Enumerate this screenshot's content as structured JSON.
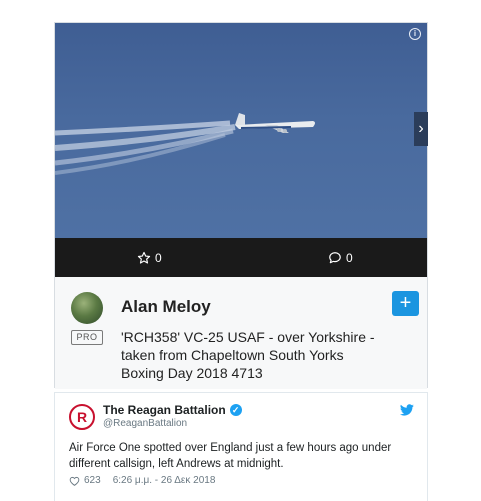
{
  "photo": {
    "favorites_count": "0",
    "comments_count": "0"
  },
  "author": {
    "name": "Alan Meloy",
    "badge": "PRO",
    "photo_title": "'RCH358' VC-25 USAF - over Yorkshire - taken from Chapeltown South Yorks Boxing Day 2018 4713",
    "follow_label": "+"
  },
  "tweet": {
    "account_name": "The Reagan Battalion",
    "handle": "@ReaganBattalion",
    "text": "Air Force One spotted over England  just a few hours ago under different callsign, left Andrews at midnight.",
    "likes": "623",
    "time": "6:26 μ.μ. - 26 Δεκ 2018",
    "verified_mark": "✓",
    "logo_letter": "R"
  },
  "icons": {
    "info": "info-icon",
    "next": "chevron-right-icon",
    "star": "star-icon",
    "comment": "comment-icon",
    "follow": "plus-icon",
    "twitter": "twitter-bird-icon",
    "like": "heart-icon"
  },
  "colors": {
    "stats_bar": "#1a1a1a",
    "follow_button": "#1b95e0",
    "twitter_blue": "#1da1f2",
    "brand_red": "#c8102e"
  }
}
